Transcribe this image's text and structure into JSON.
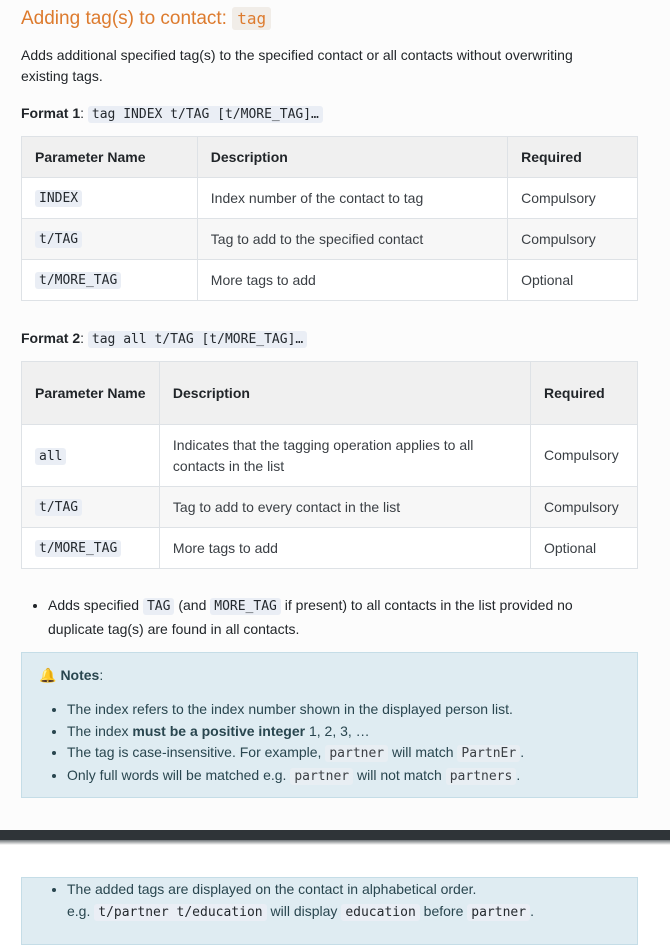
{
  "heading": {
    "text": "Adding tag(s) to contact:",
    "command": "tag"
  },
  "intro": "Adds additional specified tag(s) to the specified contact or all contacts without overwriting existing tags.",
  "format1": {
    "label": "Format 1",
    "colon": ":",
    "code": "tag INDEX t/TAG [t/MORE_TAG]…",
    "headers": [
      "Parameter Name",
      "Description",
      "Required"
    ],
    "rows": [
      {
        "param": "INDEX",
        "desc": "Index number of the contact to tag",
        "req": "Compulsory"
      },
      {
        "param": "t/TAG",
        "desc": "Tag to add to the specified contact",
        "req": "Compulsory"
      },
      {
        "param": "t/MORE_TAG",
        "desc": "More tags to add",
        "req": "Optional"
      }
    ]
  },
  "format2": {
    "label": "Format 2",
    "colon": ":",
    "code": "tag all t/TAG [t/MORE_TAG]…",
    "headers": [
      "Parameter Name",
      "Description",
      "Required"
    ],
    "rows": [
      {
        "param": "all",
        "desc": "Indicates that the tagging operation applies to all contacts in the list",
        "req": "Compulsory"
      },
      {
        "param": "t/TAG",
        "desc": "Tag to add to every contact in the list",
        "req": "Compulsory"
      },
      {
        "param": "t/MORE_TAG",
        "desc": "More tags to add",
        "req": "Optional"
      }
    ]
  },
  "bullet": {
    "pre": "Adds specified",
    "code1": "TAG",
    "mid1": "(and",
    "code2": "MORE_TAG",
    "post": "if present) to all contacts in the list provided no duplicate tag(s) are found in all contacts."
  },
  "notes": {
    "icon": "bell-icon",
    "title": "Notes",
    "colon": ":",
    "item1": "The index refers to the index number shown in the displayed person list.",
    "item2_pre": "The index",
    "item2_bold": "must be a positive integer",
    "item2_post": "1, 2, 3, …",
    "item3_pre": "The tag is case-insensitive. For example,",
    "item3_code1": "partner",
    "item3_mid": "will match",
    "item3_code2": "PartnEr",
    "item3_post": ".",
    "item4_pre": "Only full words will be matched e.g.",
    "item4_code1": "partner",
    "item4_mid": "will not match",
    "item4_code2": "partners",
    "item4_post": "."
  },
  "notes2": {
    "line1": "The added tags are displayed on the contact in alphabetical order.",
    "eg": "e.g.",
    "code1": "t/partner t/education",
    "mid": "will display",
    "code2": "education",
    "mid2": "before",
    "code3": "partner",
    "post": "."
  }
}
